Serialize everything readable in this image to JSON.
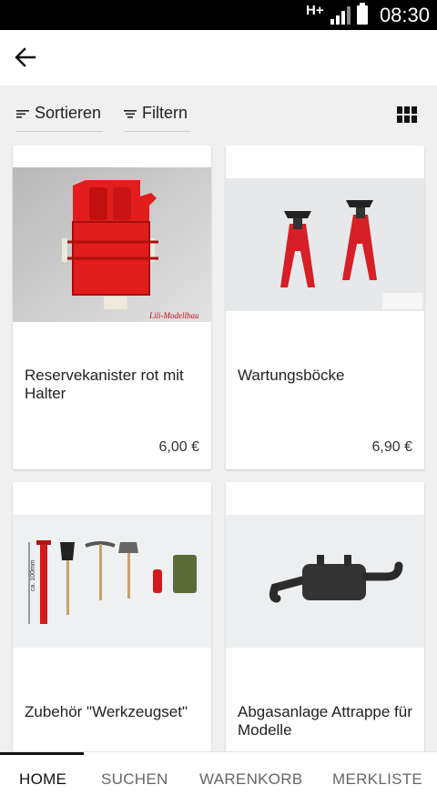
{
  "status_bar": {
    "network": "H+",
    "time": "08:30",
    "icons": [
      "signal-icon",
      "battery-icon"
    ]
  },
  "app_bar": {
    "back_icon": "arrow-left-icon"
  },
  "toolbar": {
    "sort_label": "Sortieren",
    "filter_label": "Filtern",
    "sort_icon": "sort-icon",
    "filter_icon": "filter-icon",
    "view_icon": "grid-view-icon"
  },
  "products": [
    {
      "name": "Reservekanister rot mit Halter",
      "price": "6,00 €",
      "image": "red-jerry-can-with-holder",
      "watermark": "Lili-Modellbau"
    },
    {
      "name": "Wartungsböcke",
      "price": "6,90 €",
      "image": "red-jack-stands"
    },
    {
      "name": "Zubehör \"Werkzeugset\"",
      "price": "",
      "image": "tool-set",
      "dimension_label": "ca. 100mm"
    },
    {
      "name": "Abgasanlage Attrappe für Modelle",
      "price": "",
      "image": "black-exhaust-muffler"
    }
  ],
  "bottom_nav": {
    "items": [
      "HOME",
      "SUCHEN",
      "WARENKORB",
      "MERKLISTE"
    ],
    "active": "HOME"
  },
  "colors": {
    "background": "#f0f0f0",
    "card": "#ffffff",
    "status_bar": "#000000",
    "accent_red": "#e11d1d"
  }
}
